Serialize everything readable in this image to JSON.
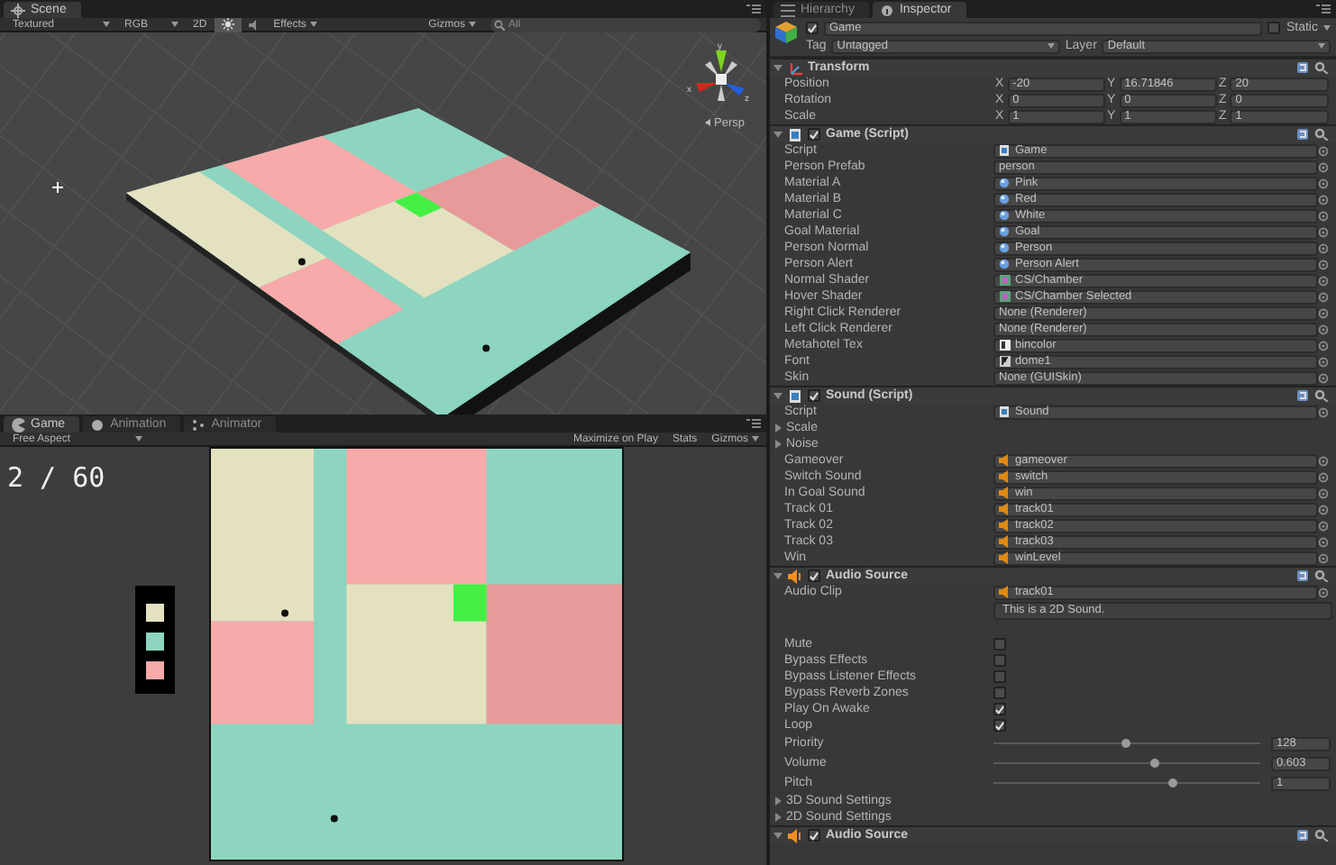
{
  "scene_panel": {
    "tabs": [
      {
        "label": "Scene",
        "selected": true
      }
    ],
    "toolbar": {
      "render_mode": "Textured",
      "color_mode": "RGB",
      "mode_2d": "2D",
      "lighting": true,
      "audio": false,
      "effects": "Effects",
      "gizmos": "Gizmos",
      "search": {
        "placeholder": "All"
      }
    },
    "gizmo_axes": [
      "y",
      "x",
      "z"
    ],
    "view_label": "Persp"
  },
  "game_panel": {
    "tabs": [
      {
        "label": "Game",
        "selected": true
      },
      {
        "label": "Animation",
        "selected": false
      },
      {
        "label": "Animator",
        "selected": false
      }
    ],
    "toolbar": {
      "aspect": "Free Aspect",
      "maximize_on_play": "Maximize on Play",
      "stats": "Stats",
      "gizmos": "Gizmos"
    },
    "score": "2 / 60",
    "legend": [
      {
        "color": "#e3e1c0"
      },
      {
        "color": "#8dd5c0"
      },
      {
        "color": "#f8a9a9"
      }
    ]
  },
  "inspector": {
    "tabs": [
      {
        "label": "Hierarchy",
        "selected": false
      },
      {
        "label": "Inspector",
        "selected": true
      }
    ],
    "object": {
      "name": "Game",
      "active": true,
      "static_label": "Static",
      "static": false,
      "tag_label": "Tag",
      "tag": "Untagged",
      "layer_label": "Layer",
      "layer": "Default"
    },
    "components": [
      {
        "kind": "transform",
        "title": "Transform",
        "expanded": true,
        "rows": [
          {
            "label": "Position",
            "values": [
              {
                "axis": "X",
                "value": "-20"
              },
              {
                "axis": "Y",
                "value": "16.71846"
              },
              {
                "axis": "Z",
                "value": "20"
              }
            ]
          },
          {
            "label": "Rotation",
            "values": [
              {
                "axis": "X",
                "value": "0"
              },
              {
                "axis": "Y",
                "value": "0"
              },
              {
                "axis": "Z",
                "value": "0"
              }
            ]
          },
          {
            "label": "Scale",
            "values": [
              {
                "axis": "X",
                "value": "1"
              },
              {
                "axis": "Y",
                "value": "1"
              },
              {
                "axis": "Z",
                "value": "1"
              }
            ]
          }
        ]
      },
      {
        "kind": "script",
        "title": "Game (Script)",
        "expanded": true,
        "enabled": true,
        "fields": [
          {
            "kind": "script",
            "label": "Script",
            "value": "Game"
          },
          {
            "kind": "reference",
            "label": "Person Prefab",
            "value": "person"
          },
          {
            "kind": "material",
            "label": "Material A",
            "value": "Pink"
          },
          {
            "kind": "material",
            "label": "Material B",
            "value": "Red"
          },
          {
            "kind": "material",
            "label": "Material C",
            "value": "White"
          },
          {
            "kind": "material",
            "label": "Goal Material",
            "value": "Goal"
          },
          {
            "kind": "material",
            "label": "Person Normal",
            "value": "Person"
          },
          {
            "kind": "material",
            "label": "Person Alert",
            "value": "Person Alert"
          },
          {
            "kind": "shader",
            "label": "Normal Shader",
            "value": "CS/Chamber"
          },
          {
            "kind": "shader",
            "label": "Hover Shader",
            "value": "CS/Chamber Selected"
          },
          {
            "kind": "reference",
            "label": "Right Click Renderer",
            "value": "None (Renderer)"
          },
          {
            "kind": "reference",
            "label": "Left Click Renderer",
            "value": "None (Renderer)"
          },
          {
            "kind": "texture",
            "label": "Metahotel Tex",
            "value": "bincolor"
          },
          {
            "kind": "font",
            "label": "Font",
            "value": "dome1"
          },
          {
            "kind": "reference",
            "label": "Skin",
            "value": "None (GUISkin)"
          }
        ]
      },
      {
        "kind": "script",
        "title": "Sound (Script)",
        "expanded": true,
        "enabled": true,
        "fields": [
          {
            "kind": "script",
            "label": "Script",
            "value": "Sound"
          },
          {
            "kind": "foldout",
            "label": "Scale",
            "expanded": false
          },
          {
            "kind": "foldout",
            "label": "Noise",
            "expanded": false
          },
          {
            "kind": "clip",
            "label": "Gameover",
            "value": "gameover"
          },
          {
            "kind": "clip",
            "label": "Switch Sound",
            "value": "switch"
          },
          {
            "kind": "clip",
            "label": "In Goal Sound",
            "value": "win"
          },
          {
            "kind": "clip",
            "label": "Track 01",
            "value": "track01"
          },
          {
            "kind": "clip",
            "label": "Track 02",
            "value": "track02"
          },
          {
            "kind": "clip",
            "label": "Track 03",
            "value": "track03"
          },
          {
            "kind": "clip",
            "label": "Win",
            "value": "winLevel"
          }
        ]
      },
      {
        "kind": "audio",
        "title": "Audio Source",
        "expanded": true,
        "enabled": true,
        "fields": [
          {
            "kind": "clip",
            "label": "Audio Clip",
            "value": "track01"
          },
          {
            "kind": "info",
            "text": "This is a 2D Sound."
          },
          {
            "kind": "checkbox",
            "label": "Mute",
            "checked": false
          },
          {
            "kind": "checkbox",
            "label": "Bypass Effects",
            "checked": false
          },
          {
            "kind": "checkbox",
            "label": "Bypass Listener Effects",
            "checked": false
          },
          {
            "kind": "checkbox",
            "label": "Bypass Reverb Zones",
            "checked": false
          },
          {
            "kind": "checkbox",
            "label": "Play On Awake",
            "checked": true
          },
          {
            "kind": "checkbox",
            "label": "Loop",
            "checked": true
          },
          {
            "kind": "slider",
            "label": "Priority",
            "level": 0.49,
            "reading": "128"
          },
          {
            "kind": "slider",
            "label": "Volume",
            "level": 0.6,
            "reading": "0.603"
          },
          {
            "kind": "slider",
            "label": "Pitch",
            "level": 0.67,
            "reading": "1"
          },
          {
            "kind": "foldout",
            "label": "3D Sound Settings",
            "expanded": false
          },
          {
            "kind": "foldout",
            "label": "2D Sound Settings",
            "expanded": false
          }
        ]
      },
      {
        "kind": "audio",
        "title": "Audio Source",
        "expanded": true,
        "enabled": true
      }
    ]
  }
}
